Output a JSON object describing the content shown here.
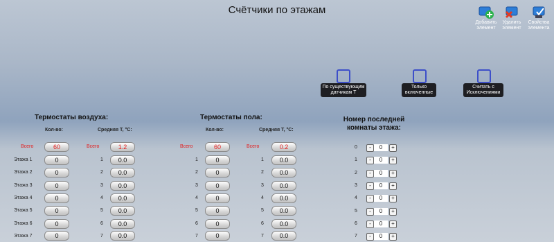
{
  "title": "Счётчики по этажам",
  "toolbar": {
    "add_label": "Добавить элемент",
    "delete_label": "Удалить элемент",
    "props_label": "Свойства элемента"
  },
  "options": {
    "existing_label": "По существующим датчикам Т",
    "enabled_label": "Только включенные",
    "exceptions_label": "Считать с Исключениями"
  },
  "air": {
    "heading": "Термостаты воздуха:",
    "count_header": "Кол-во:",
    "avg_header": "Средняя Т, °С:",
    "total_label": "Всего",
    "total_count": "60",
    "total_avg": "1.2",
    "rows": [
      {
        "label": "Этажа 1",
        "num": "1",
        "count": "0",
        "avg": "0.0"
      },
      {
        "label": "Этажа 2",
        "num": "2",
        "count": "0",
        "avg": "0.0"
      },
      {
        "label": "Этажа 3",
        "num": "3",
        "count": "0",
        "avg": "0.0"
      },
      {
        "label": "Этажа 4",
        "num": "4",
        "count": "0",
        "avg": "0.0"
      },
      {
        "label": "Этажа 5",
        "num": "5",
        "count": "0",
        "avg": "0.0"
      },
      {
        "label": "Этажа 6",
        "num": "6",
        "count": "0",
        "avg": "0.0"
      },
      {
        "label": "Этажа 7",
        "num": "7",
        "count": "0",
        "avg": "0.0"
      }
    ]
  },
  "floor": {
    "heading": "Термостаты пола:",
    "count_header": "Кол-во:",
    "avg_header": "Средняя Т, °С:",
    "total_label": "Всего",
    "total_count": "60",
    "total_avg": "0.2",
    "rows": [
      {
        "num": "1",
        "count": "0",
        "avg": "0.0"
      },
      {
        "num": "2",
        "count": "0",
        "avg": "0.0"
      },
      {
        "num": "3",
        "count": "0",
        "avg": "0.0"
      },
      {
        "num": "4",
        "count": "0",
        "avg": "0.0"
      },
      {
        "num": "5",
        "count": "0",
        "avg": "0.0"
      },
      {
        "num": "6",
        "count": "0",
        "avg": "0.0"
      },
      {
        "num": "7",
        "count": "0",
        "avg": "0.0"
      }
    ]
  },
  "rooms": {
    "heading_line1": "Номер последней",
    "heading_line2": "комнаты этажа:",
    "minus": "-",
    "plus": "+",
    "rows": [
      {
        "num": "0",
        "value": "0"
      },
      {
        "num": "1",
        "value": "0"
      },
      {
        "num": "2",
        "value": "0"
      },
      {
        "num": "3",
        "value": "0"
      },
      {
        "num": "4",
        "value": "0"
      },
      {
        "num": "5",
        "value": "0"
      },
      {
        "num": "6",
        "value": "0"
      },
      {
        "num": "7",
        "value": "0"
      }
    ]
  },
  "colors": {
    "accent_red": "#e21c1c",
    "checkbox_border": "#3d4fc9",
    "tag_bg": "#1e1e22"
  }
}
